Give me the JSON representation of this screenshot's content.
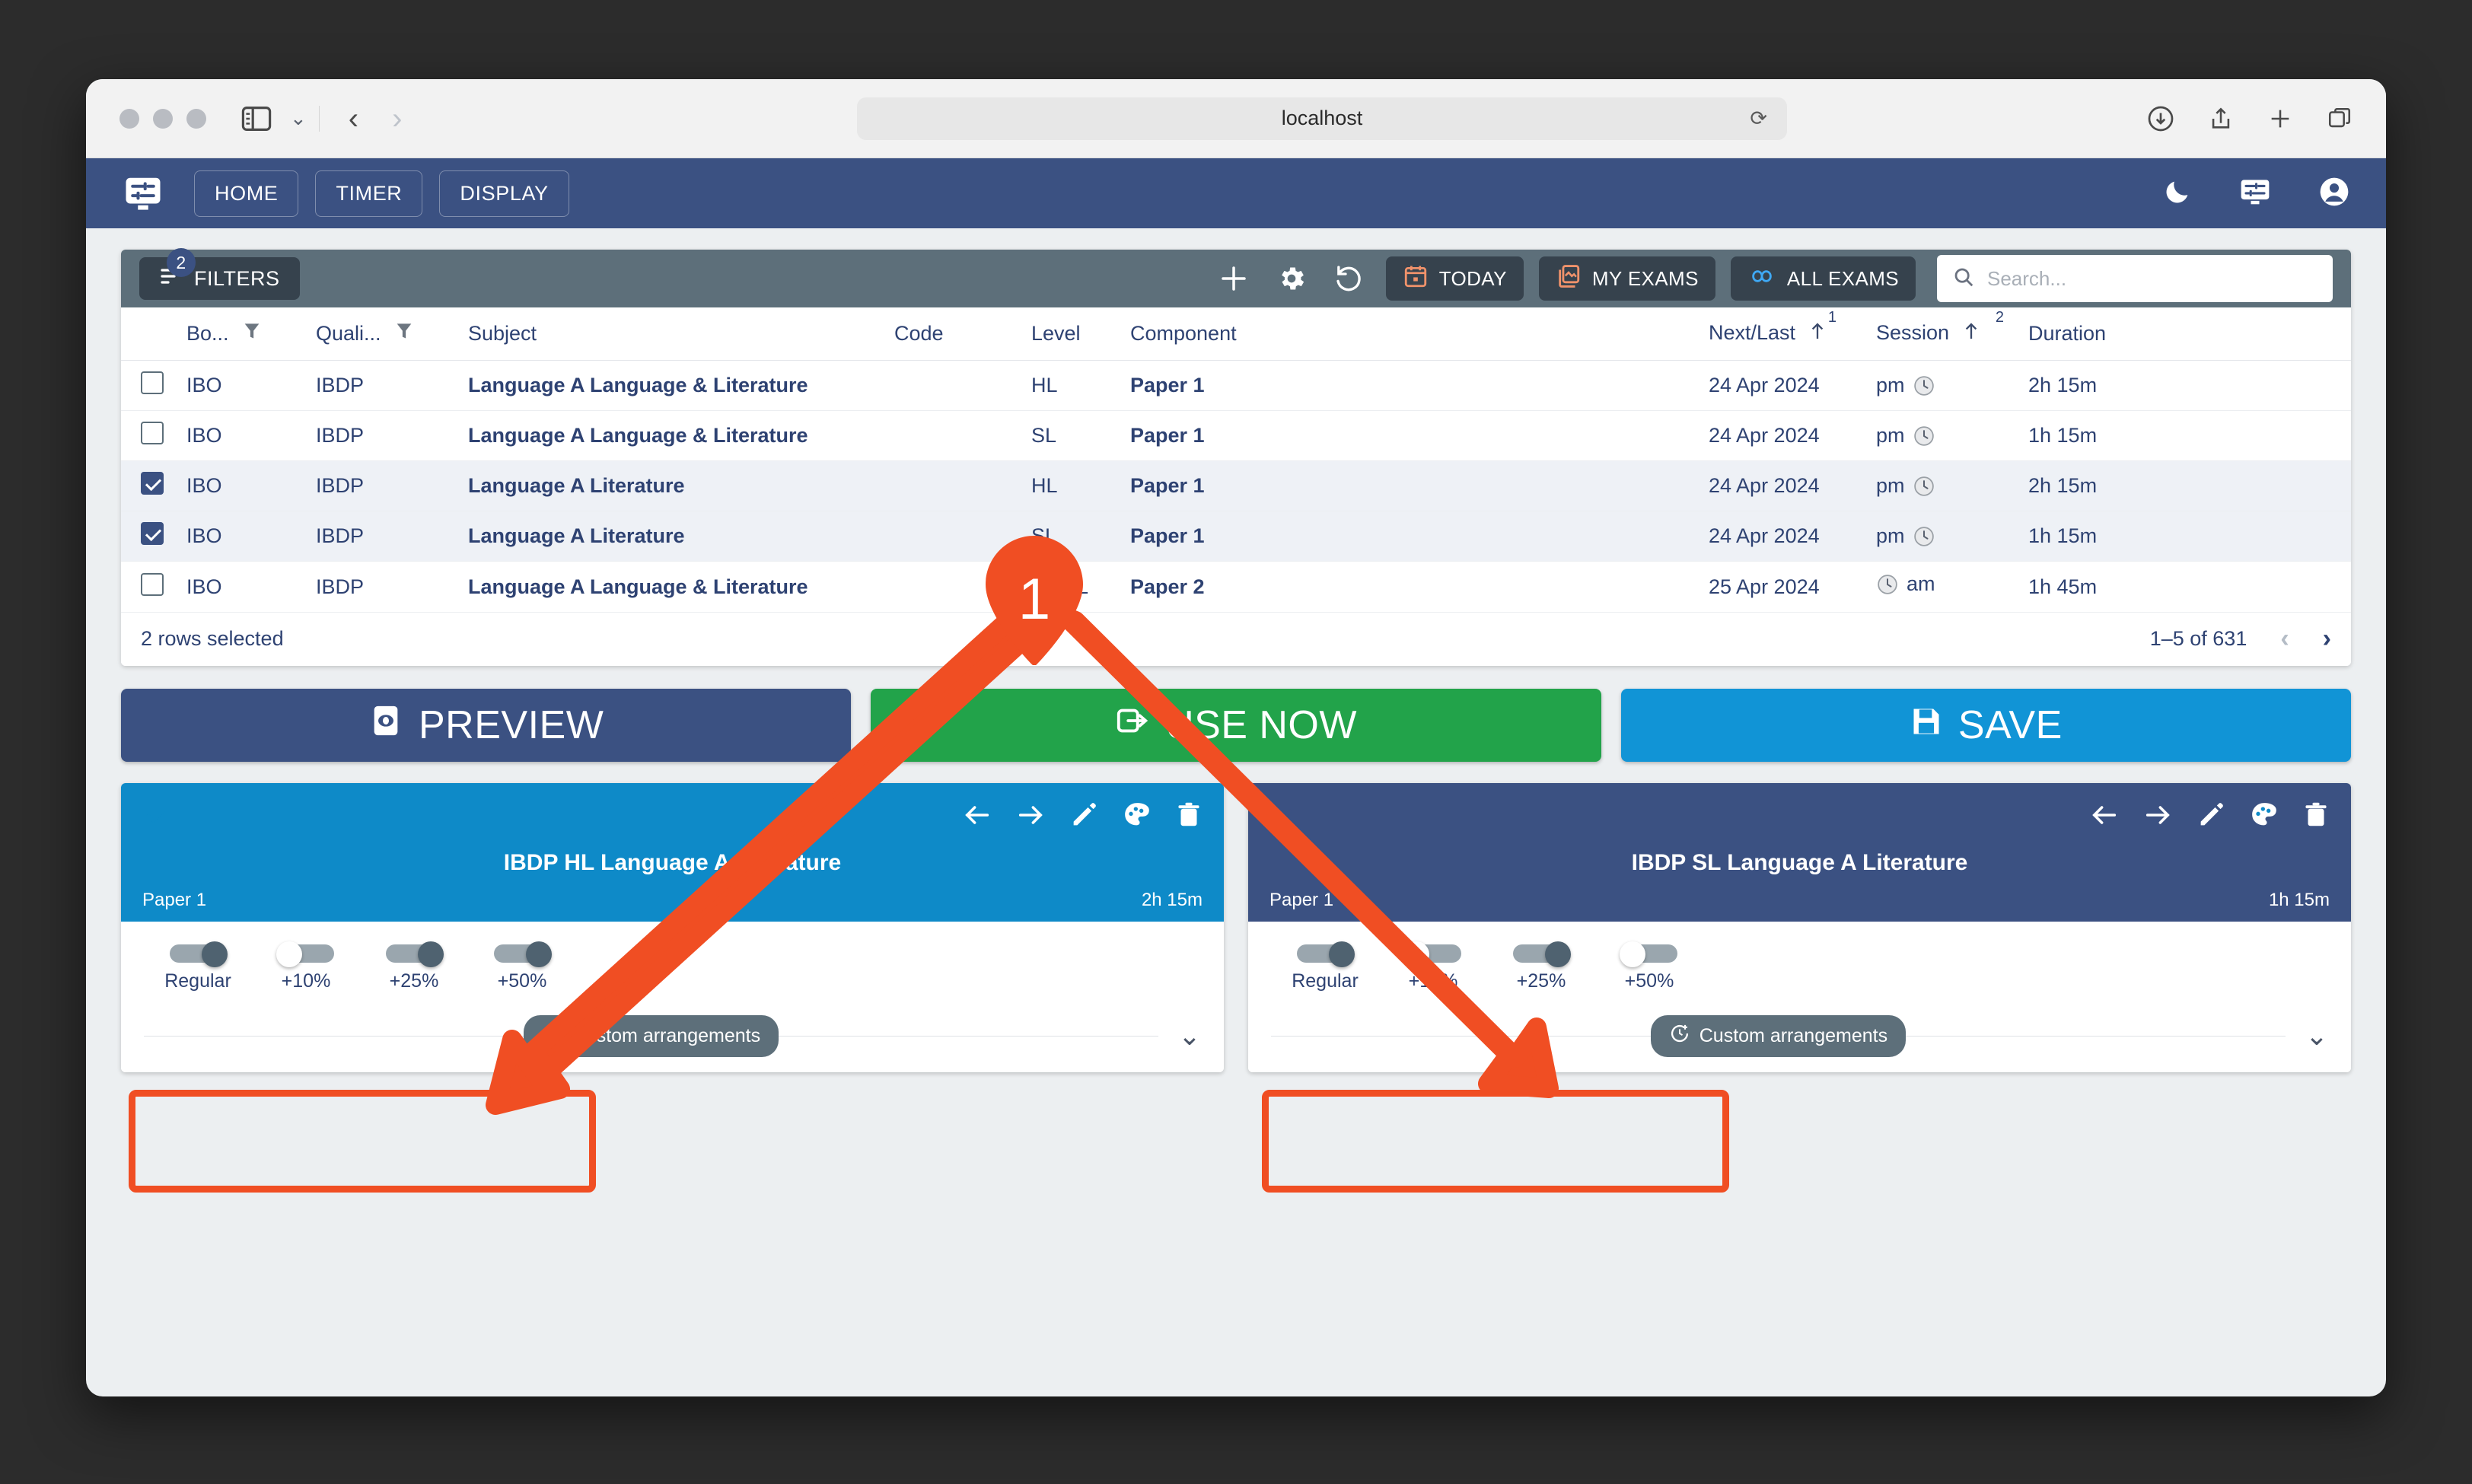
{
  "browser": {
    "url": "localhost",
    "reload_icon": "reload-icon",
    "sidebar_icon": "sidebar-toggle-icon",
    "back_icon": "back-chevron-icon",
    "forward_icon": "forward-chevron-icon",
    "download_icon": "download-icon",
    "share_icon": "share-icon",
    "newtab_icon": "plus-icon",
    "tabs_icon": "tab-overview-icon"
  },
  "appnav": {
    "brand_icon": "display-settings-icon",
    "items": [
      {
        "label": "HOME",
        "name": "nav-home"
      },
      {
        "label": "TIMER",
        "name": "nav-timer"
      },
      {
        "label": "DISPLAY",
        "name": "nav-display"
      }
    ],
    "right_icons": [
      "moon-icon",
      "display-settings-icon",
      "account-circle-icon"
    ]
  },
  "toolbar": {
    "filters_label": "FILTERS",
    "filters_badge": "2",
    "add_icon": "plus-icon",
    "settings_icon": "gear-icon",
    "refresh_icon": "restore-icon",
    "chips": [
      {
        "label": "TODAY",
        "icon": "calendar-today-icon",
        "name": "today-chip"
      },
      {
        "label": "MY EXAMS",
        "icon": "my-exams-icon",
        "name": "my-exams-chip"
      },
      {
        "label": "ALL EXAMS",
        "icon": "infinity-icon",
        "name": "all-exams-chip"
      }
    ],
    "search_placeholder": "Search...",
    "search_value": "",
    "search_icon": "search-icon"
  },
  "table": {
    "columns": [
      {
        "label": "",
        "name": "select-all"
      },
      {
        "label": "Bo...",
        "name": "board",
        "filter": true
      },
      {
        "label": "Quali...",
        "name": "qualification",
        "filter": true
      },
      {
        "label": "Subject",
        "name": "subject"
      },
      {
        "label": "Code",
        "name": "code"
      },
      {
        "label": "Level",
        "name": "level"
      },
      {
        "label": "Component",
        "name": "component"
      },
      {
        "label": "Next/Last",
        "name": "next-last",
        "sort": "asc",
        "sort_order": "1"
      },
      {
        "label": "Session",
        "name": "session",
        "sort": "asc",
        "sort_order": "2"
      },
      {
        "label": "Duration",
        "name": "duration"
      }
    ],
    "rows": [
      {
        "checked": false,
        "board": "IBO",
        "qual": "IBDP",
        "subject": "Language A Language & Literature",
        "code": "",
        "level": "HL",
        "component": "Paper 1",
        "date": "24 Apr 2024",
        "session": "pm",
        "session_icon_side": "right",
        "duration": "2h 15m"
      },
      {
        "checked": false,
        "board": "IBO",
        "qual": "IBDP",
        "subject": "Language A Language & Literature",
        "code": "",
        "level": "SL",
        "component": "Paper 1",
        "date": "24 Apr 2024",
        "session": "pm",
        "session_icon_side": "right",
        "duration": "1h 15m"
      },
      {
        "checked": true,
        "board": "IBO",
        "qual": "IBDP",
        "subject": "Language A Literature",
        "code": "",
        "level": "HL",
        "component": "Paper 1",
        "date": "24 Apr 2024",
        "session": "pm",
        "session_icon_side": "right",
        "duration": "2h 15m"
      },
      {
        "checked": true,
        "board": "IBO",
        "qual": "IBDP",
        "subject": "Language A Literature",
        "code": "",
        "level": "SL",
        "component": "Paper 1",
        "date": "24 Apr 2024",
        "session": "pm",
        "session_icon_side": "right",
        "duration": "1h 15m"
      },
      {
        "checked": false,
        "board": "IBO",
        "qual": "IBDP",
        "subject": "Language A Language & Literature",
        "code": "",
        "level": "HL/SL",
        "component": "Paper 2",
        "date": "25 Apr 2024",
        "session": "am",
        "session_icon_side": "left",
        "duration": "1h 45m"
      }
    ],
    "footer": {
      "selection": "2 rows selected",
      "range": "1–5 of 631",
      "prev_icon": "chevron-left-icon",
      "next_icon": "chevron-right-icon"
    }
  },
  "actions": [
    {
      "label": "PREVIEW",
      "icon": "preview-eye-icon",
      "color": "#3b5182",
      "name": "preview-button"
    },
    {
      "label": "USE NOW",
      "icon": "use-now-icon",
      "color": "#22a34a",
      "name": "use-now-button"
    },
    {
      "label": "SAVE",
      "icon": "save-disk-icon",
      "color": "#1194d6",
      "name": "save-button"
    }
  ],
  "cards": [
    {
      "name": "exam-card-hl",
      "header_color": "#0e8ac8",
      "checked": true,
      "title": "IBDP HL Language A Literature",
      "component": "Paper 1",
      "duration": "2h 15m",
      "actions": [
        "arrow-left-icon",
        "arrow-right-icon",
        "pencil-icon",
        "palette-icon",
        "trash-icon"
      ],
      "toggles": [
        {
          "label": "Regular",
          "on": true
        },
        {
          "label": "+10%",
          "on": false
        },
        {
          "label": "+25%",
          "on": true
        },
        {
          "label": "+50%",
          "on": true
        }
      ],
      "arrangements_label": "Custom arrangements",
      "arrangements_icon": "timer-plus-icon",
      "expand_icon": "chevron-down-icon"
    },
    {
      "name": "exam-card-sl",
      "header_color": "#3b5182",
      "checked": true,
      "title": "IBDP SL Language A Literature",
      "component": "Paper 1",
      "duration": "1h 15m",
      "actions": [
        "arrow-left-icon",
        "arrow-right-icon",
        "pencil-icon",
        "palette-icon",
        "trash-icon"
      ],
      "toggles": [
        {
          "label": "Regular",
          "on": true
        },
        {
          "label": "+10%",
          "on": false
        },
        {
          "label": "+25%",
          "on": true
        },
        {
          "label": "+50%",
          "on": false
        }
      ],
      "arrangements_label": "Custom arrangements",
      "arrangements_icon": "timer-plus-icon",
      "expand_icon": "chevron-down-icon"
    }
  ],
  "annotations": {
    "marker_number": "1",
    "accent_color": "#f04e23"
  }
}
